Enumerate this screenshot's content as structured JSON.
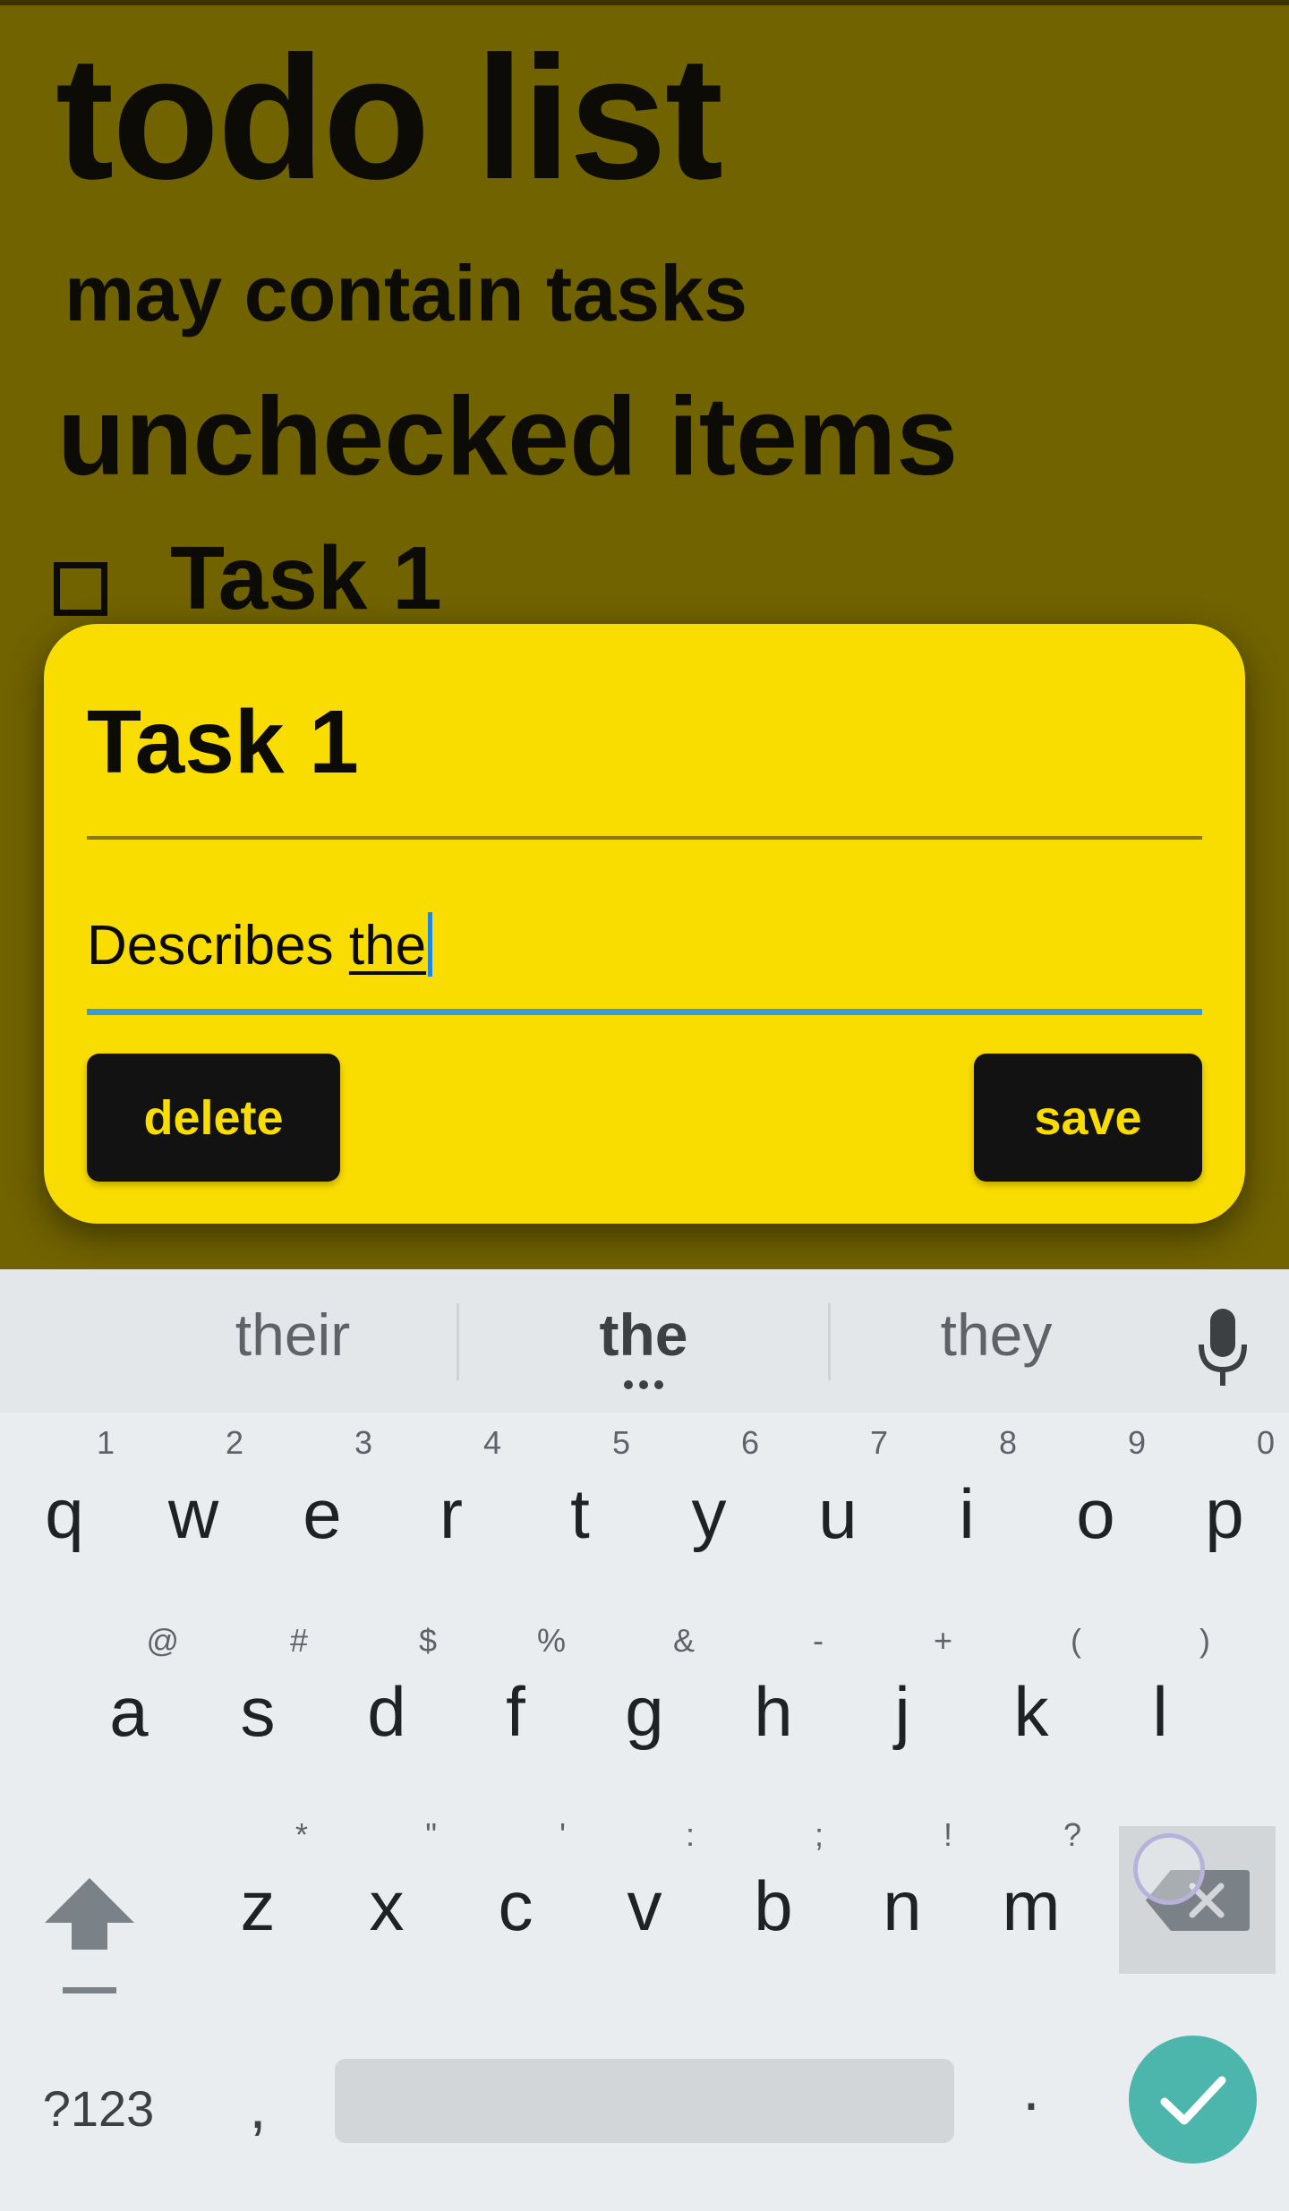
{
  "app": {
    "title": "todo list",
    "subtitle": "may contain tasks",
    "section_heading": "unchecked items",
    "tasks": [
      {
        "label": "Task 1",
        "checked": false
      }
    ],
    "background_color": "#fadd00"
  },
  "dialog": {
    "title": "Task 1",
    "description_prefix": "Describes ",
    "description_composing": "the",
    "delete_label": "delete",
    "save_label": "save",
    "button_color": "#121212",
    "button_text_color": "#fadd00",
    "focus_underline_color": "#3a9bd9"
  },
  "keyboard": {
    "suggestions": [
      "their",
      "the",
      "they"
    ],
    "primary_suggestion_index": 1,
    "mic_icon": "microphone-icon",
    "row1": [
      {
        "key": "q",
        "hint": "1"
      },
      {
        "key": "w",
        "hint": "2"
      },
      {
        "key": "e",
        "hint": "3"
      },
      {
        "key": "r",
        "hint": "4"
      },
      {
        "key": "t",
        "hint": "5"
      },
      {
        "key": "y",
        "hint": "6"
      },
      {
        "key": "u",
        "hint": "7"
      },
      {
        "key": "i",
        "hint": "8"
      },
      {
        "key": "o",
        "hint": "9"
      },
      {
        "key": "p",
        "hint": "0"
      }
    ],
    "row2": [
      {
        "key": "a",
        "hint": "@"
      },
      {
        "key": "s",
        "hint": "#"
      },
      {
        "key": "d",
        "hint": "$"
      },
      {
        "key": "f",
        "hint": "%"
      },
      {
        "key": "g",
        "hint": "&"
      },
      {
        "key": "h",
        "hint": "-"
      },
      {
        "key": "j",
        "hint": "+"
      },
      {
        "key": "k",
        "hint": "("
      },
      {
        "key": "l",
        "hint": ")"
      }
    ],
    "row3": [
      {
        "key": "z",
        "hint": "*"
      },
      {
        "key": "x",
        "hint": "\""
      },
      {
        "key": "c",
        "hint": "'"
      },
      {
        "key": "v",
        "hint": ":"
      },
      {
        "key": "b",
        "hint": ";"
      },
      {
        "key": "n",
        "hint": "!"
      },
      {
        "key": "m",
        "hint": "?"
      }
    ],
    "symbols_label": "?123",
    "comma_label": ",",
    "period_label": ".",
    "shift_icon": "shift-icon",
    "backspace_icon": "backspace-icon",
    "enter_icon": "checkmark-icon",
    "enter_color": "#4db6ac"
  }
}
